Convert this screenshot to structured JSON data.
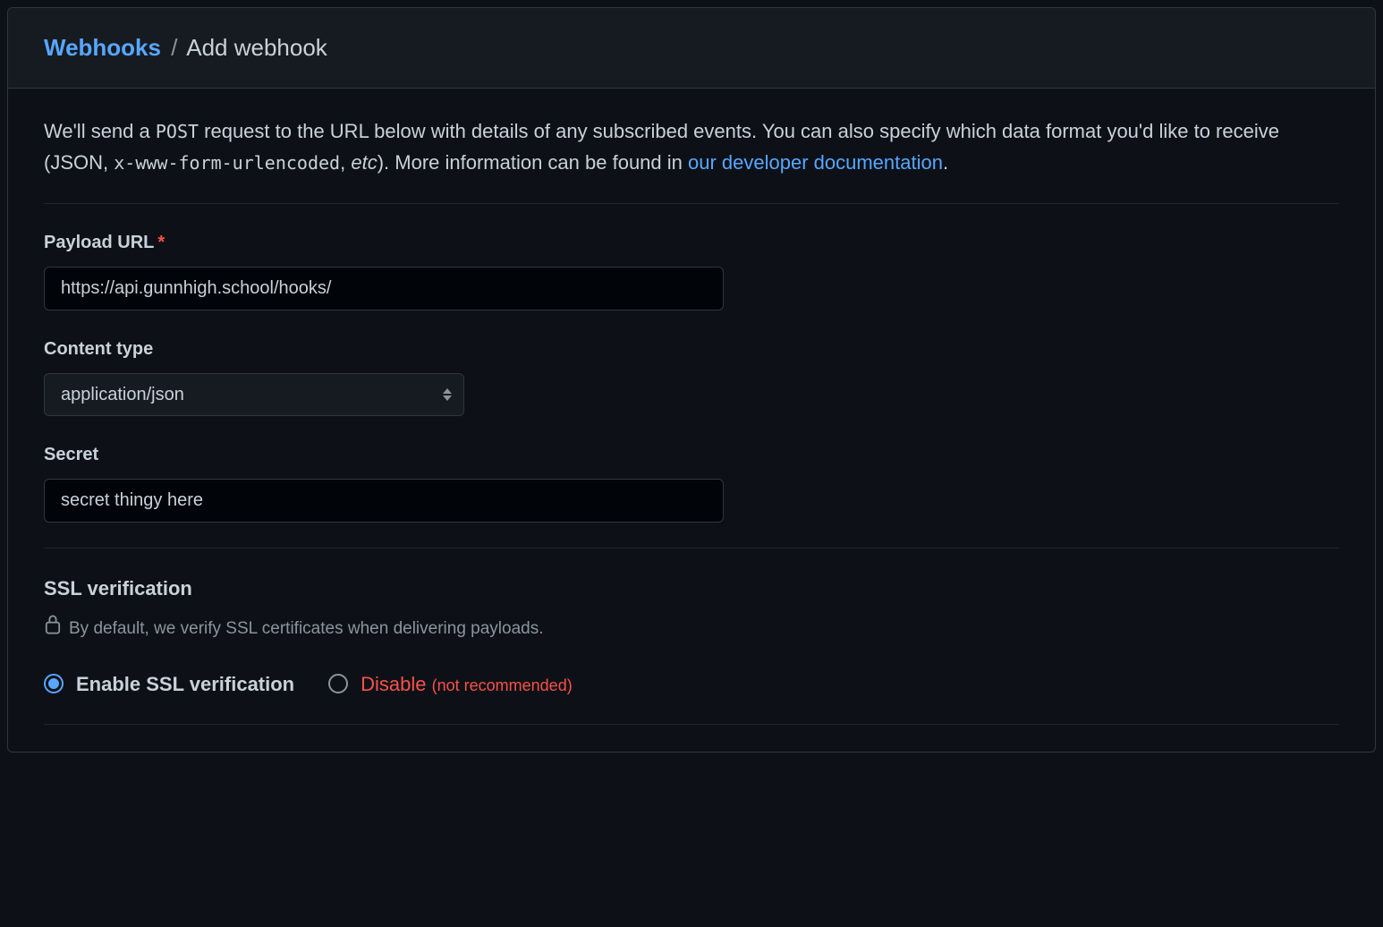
{
  "breadcrumb": {
    "parent": "Webhooks",
    "separator": "/",
    "current": "Add webhook"
  },
  "description": {
    "text1": "We'll send a ",
    "code1": "POST",
    "text2": " request to the URL below with details of any subscribed events. You can also specify which data format you'd like to receive (JSON, ",
    "code2": "x-www-form-urlencoded",
    "text3": ", ",
    "em1": "etc",
    "text4": "). More information can be found in ",
    "link_text": "our developer documentation",
    "text5": "."
  },
  "form": {
    "payload_url": {
      "label": "Payload URL",
      "required_star": "*",
      "value": "https://api.gunnhigh.school/hooks/"
    },
    "content_type": {
      "label": "Content type",
      "value": "application/json"
    },
    "secret": {
      "label": "Secret",
      "value": "secret thingy here"
    },
    "ssl": {
      "heading": "SSL verification",
      "note": "By default, we verify SSL certificates when delivering payloads.",
      "enable_label": "Enable SSL verification",
      "disable_label": "Disable",
      "disable_note": "(not recommended)"
    }
  }
}
